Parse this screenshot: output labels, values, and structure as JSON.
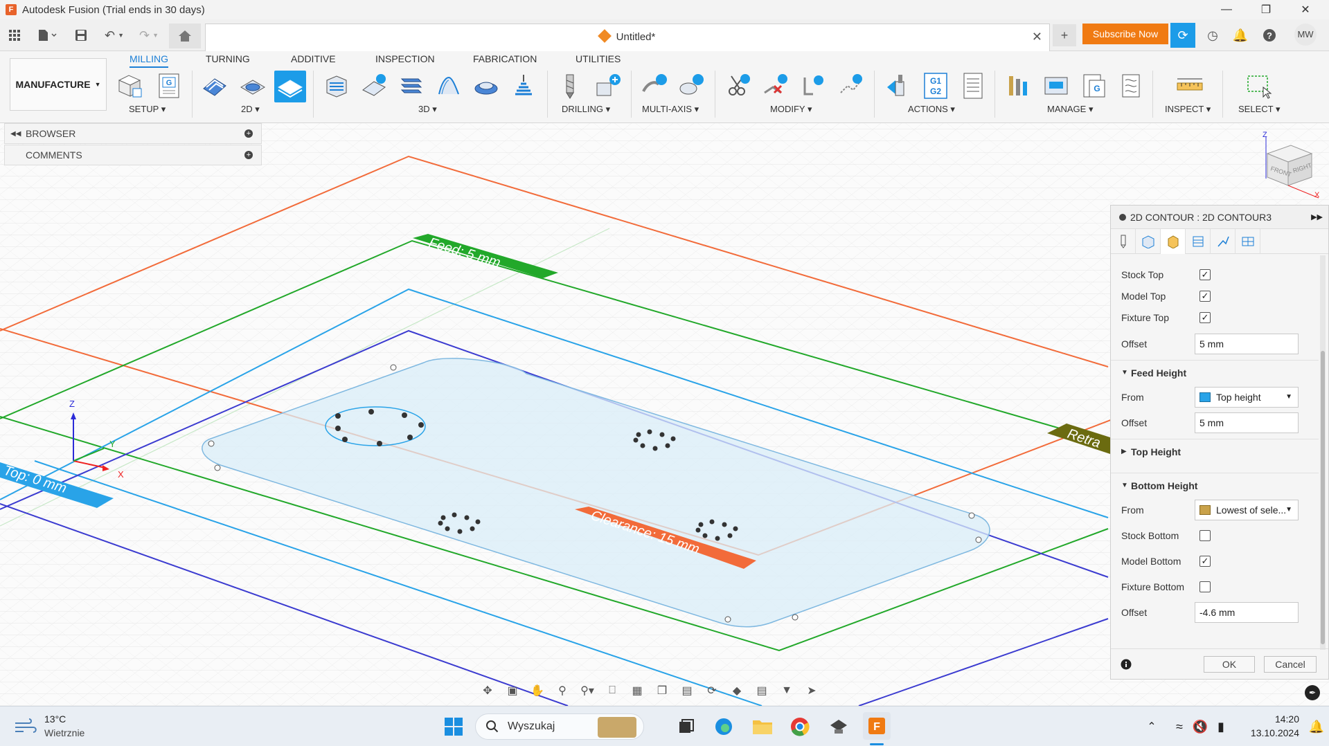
{
  "window": {
    "title": "Autodesk Fusion (Trial ends in 30 days)"
  },
  "document": {
    "title": "Untitled*"
  },
  "header": {
    "subscribe_label": "Subscribe Now",
    "user_initials": "MW"
  },
  "ribbon": {
    "workspace": "MANUFACTURE",
    "tabs": [
      "MILLING",
      "TURNING",
      "ADDITIVE",
      "INSPECTION",
      "FABRICATION",
      "UTILITIES"
    ],
    "active_tab": "MILLING",
    "groups": [
      "SETUP",
      "2D",
      "3D",
      "DRILLING",
      "MULTI-AXIS",
      "MODIFY",
      "ACTIONS",
      "MANAGE",
      "INSPECT",
      "SELECT"
    ]
  },
  "browser": {
    "items": [
      "BROWSER",
      "COMMENTS"
    ]
  },
  "viewport": {
    "labels": {
      "feed": "Feed: 5 mm",
      "top": "Top: 0 mm",
      "clearance": "Clearance: 15 mm",
      "retract": "Retra"
    },
    "viewcube": {
      "front": "FRONT",
      "right": "RIGHT",
      "axis_z": "Z",
      "axis_x": "X"
    },
    "triad": {
      "x": "X",
      "y": "Y",
      "z": "Z"
    }
  },
  "dialog": {
    "title": "2D CONTOUR : 2D CONTOUR3",
    "rows": [
      {
        "label": "Stock Top",
        "checked": true
      },
      {
        "label": "Model Top",
        "checked": true
      },
      {
        "label": "Fixture Top",
        "checked": true
      }
    ],
    "top_offset": {
      "label": "Offset",
      "value": "5 mm"
    },
    "feed_height": {
      "title": "Feed Height",
      "from_label": "From",
      "from_value": "Top height",
      "offset_label": "Offset",
      "offset_value": "5 mm"
    },
    "top_height": {
      "title": "Top Height"
    },
    "bottom_height": {
      "title": "Bottom Height",
      "from_label": "From",
      "from_value": "Lowest of sele...",
      "rows": [
        {
          "label": "Stock Bottom",
          "checked": false
        },
        {
          "label": "Model Bottom",
          "checked": true
        },
        {
          "label": "Fixture Bottom",
          "checked": false
        }
      ],
      "offset_label": "Offset",
      "offset_value": "-4.6 mm"
    },
    "ok_label": "OK",
    "cancel_label": "Cancel"
  },
  "taskbar": {
    "weather_temp": "13°C",
    "weather_desc": "Wietrznie",
    "search_placeholder": "Wyszukaj",
    "time": "14:20",
    "date": "13.10.2024"
  },
  "colors": {
    "accent": "#1c7fd6",
    "subscribe": "#f07a12",
    "feed_plane": "#22a82a",
    "top_plane": "#29a3e8",
    "clearance_plane": "#f26b3a",
    "bottom_plane": "#3b3bd0"
  }
}
